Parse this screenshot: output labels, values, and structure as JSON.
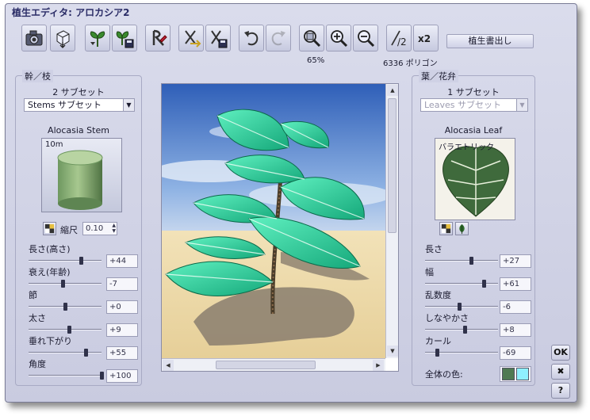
{
  "window": {
    "title": "植生エディタ: アロカシア2"
  },
  "toolbar": {
    "zoom_percent": "65%",
    "polygon_count": "6336 ポリゴン",
    "export_label": "植生書出し",
    "buttons": [
      {
        "icon": "camera-icon",
        "state": "enabled"
      },
      {
        "icon": "cube-view-icon",
        "state": "enabled"
      },
      {
        "icon": "plant-load-icon",
        "state": "enabled"
      },
      {
        "icon": "plant-save-icon",
        "state": "enabled"
      },
      {
        "icon": "paint-brush-icon",
        "state": "enabled"
      },
      {
        "icon": "random-branch-icon",
        "state": "enabled"
      },
      {
        "icon": "branch-save-icon",
        "state": "enabled"
      },
      {
        "icon": "undo-icon",
        "state": "enabled"
      },
      {
        "icon": "redo-icon",
        "state": "disabled"
      },
      {
        "icon": "zoom-fit-icon",
        "state": "enabled"
      },
      {
        "icon": "zoom-in-icon",
        "state": "enabled"
      },
      {
        "icon": "zoom-out-icon",
        "state": "enabled"
      },
      {
        "icon": "halve-polygons-icon",
        "label": "/2",
        "state": "enabled"
      },
      {
        "icon": "double-polygons-icon",
        "label": "x2",
        "state": "enabled"
      }
    ]
  },
  "stems": {
    "title": "幹／枝",
    "subset_count": "2 サブセット",
    "subset_selected": "Stems サブセット",
    "material_name": "Alocasia Stem",
    "thumb_label": "10m",
    "scale_label": "縮尺",
    "scale_value": "0.10",
    "sliders": [
      {
        "label": "長さ(高さ)",
        "value": "+44",
        "level": 0.72
      },
      {
        "label": "衰え(年齢)",
        "value": "-7",
        "level": 0.47
      },
      {
        "label": "節",
        "value": "+0",
        "level": 0.5
      },
      {
        "label": "太さ",
        "value": "+9",
        "level": 0.55
      },
      {
        "label": "垂れ下がり",
        "value": "+55",
        "level": 0.78
      },
      {
        "label": "角度",
        "value": "+100",
        "level": 1.0
      }
    ]
  },
  "leaves": {
    "title": "葉／花弁",
    "subset_count": "1 サブセット",
    "subset_selected": "Leaves サブセット",
    "material_name": "Alocasia Leaf",
    "thumb_label": "バラエトリック",
    "sliders": [
      {
        "label": "長さ",
        "value": "+27",
        "level": 0.63
      },
      {
        "label": "幅",
        "value": "+61",
        "level": 0.8
      },
      {
        "label": "乱数度",
        "value": "-6",
        "level": 0.47
      },
      {
        "label": "しなやかさ",
        "value": "+8",
        "level": 0.54
      },
      {
        "label": "カール",
        "value": "-69",
        "level": 0.16
      }
    ],
    "overall_color_label": "全体の色:",
    "overall_colors": [
      "#4f7a52",
      "#8ff0ff"
    ]
  },
  "side_buttons": {
    "ok": "OK",
    "cancel": "✖",
    "help": "?"
  },
  "colors": {
    "window_bg": "#cfd1e5",
    "title_text": "#2a2c66",
    "sky": "#3f73c9",
    "ground": "#ecd8a8",
    "leaf": "#33d29a"
  }
}
